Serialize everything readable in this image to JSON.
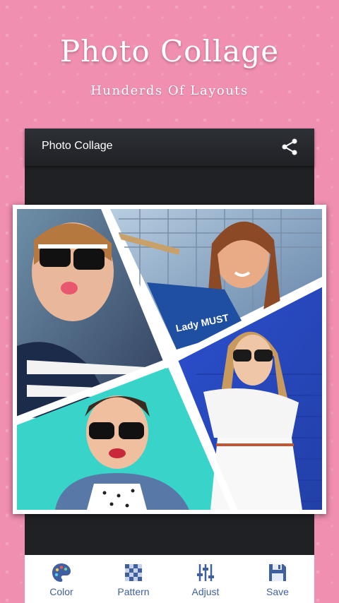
{
  "promo": {
    "title": "Photo Collage",
    "subtitle": "Hunderds Of Layouts"
  },
  "app_bar": {
    "title": "Photo Collage",
    "share_icon": "share-icon"
  },
  "collage": {
    "photo_text": "Lady MUST"
  },
  "toolbar": {
    "items": [
      {
        "label": "Color",
        "icon": "palette-icon"
      },
      {
        "label": "Pattern",
        "icon": "checkerboard-icon"
      },
      {
        "label": "Adjust",
        "icon": "sliders-icon"
      },
      {
        "label": "Save",
        "icon": "floppy-disk-icon"
      }
    ]
  },
  "colors": {
    "background": "#f08fb0",
    "app_bar": "#2d3036",
    "accent": "#3f5fa0"
  }
}
